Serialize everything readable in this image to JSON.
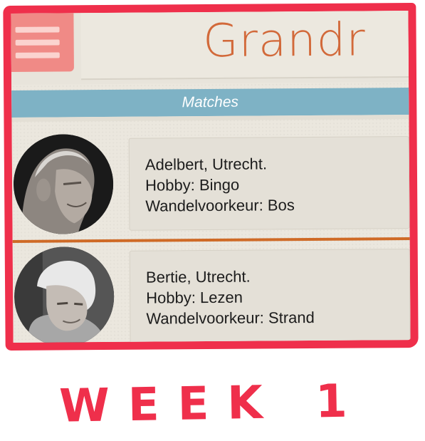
{
  "header": {
    "logo": "Grandr"
  },
  "matches_bar": {
    "title": "Matches"
  },
  "matches": [
    {
      "name_city": "Adelbert, Utrecht.",
      "hobby": "Hobby: Bingo",
      "walk": "Wandelvoorkeur: Bos"
    },
    {
      "name_city": "Bertie, Utrecht.",
      "hobby": "Hobby: Lezen",
      "walk": "Wandelvoorkeur: Strand"
    }
  ],
  "caption": "WEEK 1",
  "colors": {
    "frame": "#ef2f4b",
    "menu": "#f08a86",
    "logo": "#d2693a",
    "bar": "#7eb2c5",
    "divider": "#cf6a26"
  }
}
